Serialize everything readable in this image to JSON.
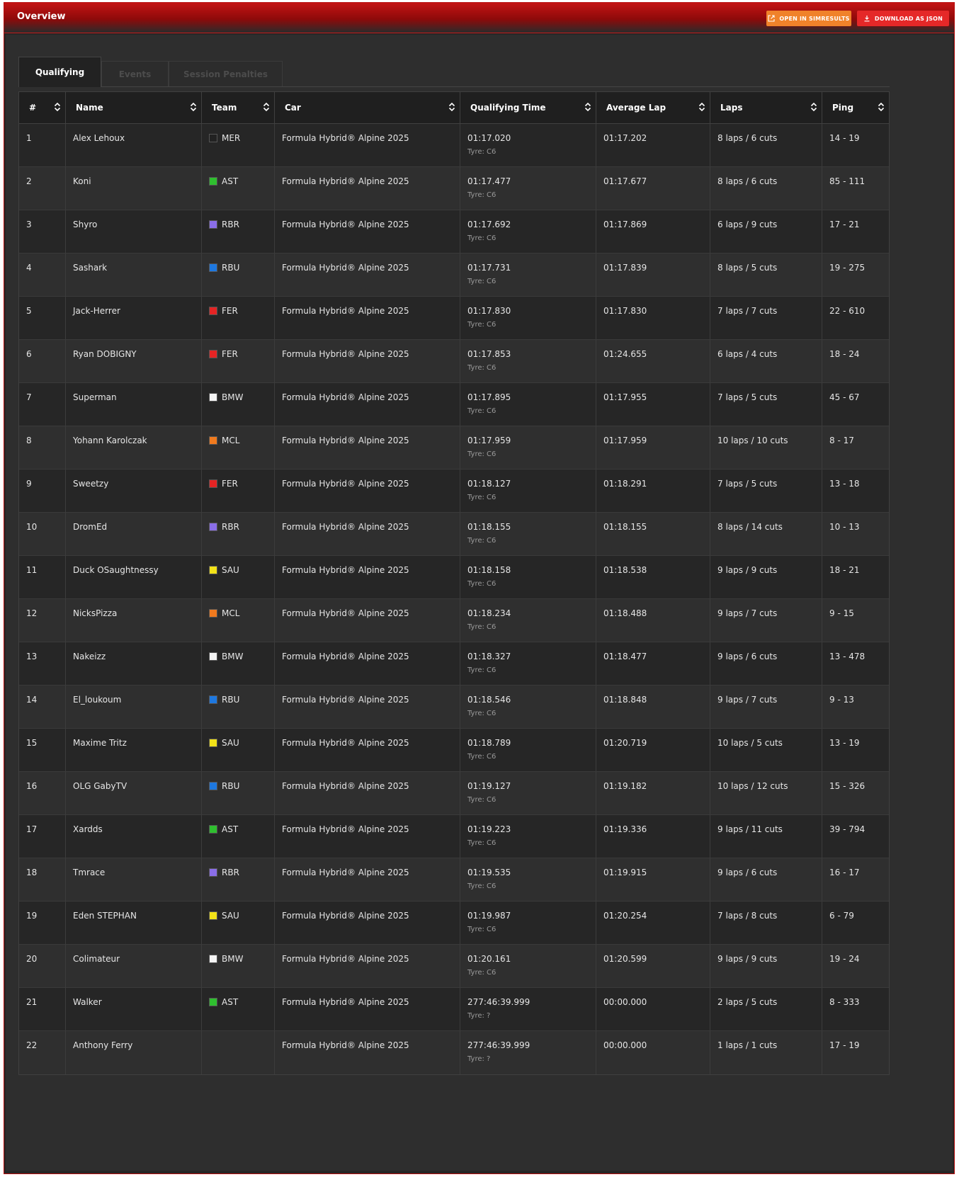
{
  "header": {
    "title": "Overview",
    "open_button": "Open in SimResults",
    "download_button": "Download as JSON",
    "open_icon": "external-link-icon",
    "download_icon": "download-icon"
  },
  "tabs": [
    {
      "label": "Qualifying",
      "active": true
    },
    {
      "label": "Events",
      "active": false
    },
    {
      "label": "Session Penalties",
      "active": false
    }
  ],
  "table": {
    "columns": [
      "#",
      "Name",
      "Team",
      "Car",
      "Qualifying Time",
      "Average Lap",
      "Laps",
      "Ping"
    ],
    "sort_icon": "sort-icon",
    "rows": [
      {
        "pos": "1",
        "name": "Alex Lehoux",
        "team": "MER",
        "team_color": "#222222",
        "car": "Formula Hybrid® Alpine 2025",
        "time": "01:17.020",
        "tyre": "Tyre: C6",
        "avg": "01:17.202",
        "laps": "8 laps / 6 cuts",
        "ping": "14 - 19"
      },
      {
        "pos": "2",
        "name": "Koni",
        "team": "AST",
        "team_color": "#2fbf2f",
        "car": "Formula Hybrid® Alpine 2025",
        "time": "01:17.477",
        "tyre": "Tyre: C6",
        "avg": "01:17.677",
        "laps": "8 laps / 6 cuts",
        "ping": "85 - 111"
      },
      {
        "pos": "3",
        "name": "Shyro",
        "team": "RBR",
        "team_color": "#8a6ee8",
        "car": "Formula Hybrid® Alpine 2025",
        "time": "01:17.692",
        "tyre": "Tyre: C6",
        "avg": "01:17.869",
        "laps": "6 laps / 9 cuts",
        "ping": "17 - 21"
      },
      {
        "pos": "4",
        "name": "Sashark",
        "team": "RBU",
        "team_color": "#1e78e0",
        "car": "Formula Hybrid® Alpine 2025",
        "time": "01:17.731",
        "tyre": "Tyre: C6",
        "avg": "01:17.839",
        "laps": "8 laps / 5 cuts",
        "ping": "19 - 275"
      },
      {
        "pos": "5",
        "name": "Jack-Herrer",
        "team": "FER",
        "team_color": "#e52424",
        "car": "Formula Hybrid® Alpine 2025",
        "time": "01:17.830",
        "tyre": "Tyre: C6",
        "avg": "01:17.830",
        "laps": "7 laps / 7 cuts",
        "ping": "22 - 610"
      },
      {
        "pos": "6",
        "name": "Ryan DOBIGNY",
        "team": "FER",
        "team_color": "#e52424",
        "car": "Formula Hybrid® Alpine 2025",
        "time": "01:17.853",
        "tyre": "Tyre: C6",
        "avg": "01:24.655",
        "laps": "6 laps / 4 cuts",
        "ping": "18 - 24"
      },
      {
        "pos": "7",
        "name": "Superman",
        "team": "BMW",
        "team_color": "#f4f4f4",
        "car": "Formula Hybrid® Alpine 2025",
        "time": "01:17.895",
        "tyre": "Tyre: C6",
        "avg": "01:17.955",
        "laps": "7 laps / 5 cuts",
        "ping": "45 - 67"
      },
      {
        "pos": "8",
        "name": "Yohann Karolczak",
        "team": "MCL",
        "team_color": "#f07a1e",
        "car": "Formula Hybrid® Alpine 2025",
        "time": "01:17.959",
        "tyre": "Tyre: C6",
        "avg": "01:17.959",
        "laps": "10 laps / 10 cuts",
        "ping": "8 - 17"
      },
      {
        "pos": "9",
        "name": "Sweetzy",
        "team": "FER",
        "team_color": "#e52424",
        "car": "Formula Hybrid® Alpine 2025",
        "time": "01:18.127",
        "tyre": "Tyre: C6",
        "avg": "01:18.291",
        "laps": "7 laps / 5 cuts",
        "ping": "13 - 18"
      },
      {
        "pos": "10",
        "name": "DromEd",
        "team": "RBR",
        "team_color": "#8a6ee8",
        "car": "Formula Hybrid® Alpine 2025",
        "time": "01:18.155",
        "tyre": "Tyre: C6",
        "avg": "01:18.155",
        "laps": "8 laps / 14 cuts",
        "ping": "10 - 13"
      },
      {
        "pos": "11",
        "name": "Duck OSaughtnessy",
        "team": "SAU",
        "team_color": "#f2e218",
        "car": "Formula Hybrid® Alpine 2025",
        "time": "01:18.158",
        "tyre": "Tyre: C6",
        "avg": "01:18.538",
        "laps": "9 laps / 9 cuts",
        "ping": "18 - 21"
      },
      {
        "pos": "12",
        "name": "NicksPizza",
        "team": "MCL",
        "team_color": "#f07a1e",
        "car": "Formula Hybrid® Alpine 2025",
        "time": "01:18.234",
        "tyre": "Tyre: C6",
        "avg": "01:18.488",
        "laps": "9 laps / 7 cuts",
        "ping": "9 - 15"
      },
      {
        "pos": "13",
        "name": "Nakeizz",
        "team": "BMW",
        "team_color": "#f4f4f4",
        "car": "Formula Hybrid® Alpine 2025",
        "time": "01:18.327",
        "tyre": "Tyre: C6",
        "avg": "01:18.477",
        "laps": "9 laps / 6 cuts",
        "ping": "13 - 478"
      },
      {
        "pos": "14",
        "name": "El_loukoum",
        "team": "RBU",
        "team_color": "#1e78e0",
        "car": "Formula Hybrid® Alpine 2025",
        "time": "01:18.546",
        "tyre": "Tyre: C6",
        "avg": "01:18.848",
        "laps": "9 laps / 7 cuts",
        "ping": "9 - 13"
      },
      {
        "pos": "15",
        "name": "Maxime Tritz",
        "team": "SAU",
        "team_color": "#f2e218",
        "car": "Formula Hybrid® Alpine 2025",
        "time": "01:18.789",
        "tyre": "Tyre: C6",
        "avg": "01:20.719",
        "laps": "10 laps / 5 cuts",
        "ping": "13 - 19"
      },
      {
        "pos": "16",
        "name": "OLG GabyTV",
        "team": "RBU",
        "team_color": "#1e78e0",
        "car": "Formula Hybrid® Alpine 2025",
        "time": "01:19.127",
        "tyre": "Tyre: C6",
        "avg": "01:19.182",
        "laps": "10 laps / 12 cuts",
        "ping": "15 - 326"
      },
      {
        "pos": "17",
        "name": "Xardds",
        "team": "AST",
        "team_color": "#2fbf2f",
        "car": "Formula Hybrid® Alpine 2025",
        "time": "01:19.223",
        "tyre": "Tyre: C6",
        "avg": "01:19.336",
        "laps": "9 laps / 11 cuts",
        "ping": "39 - 794"
      },
      {
        "pos": "18",
        "name": "Tmrace",
        "team": "RBR",
        "team_color": "#8a6ee8",
        "car": "Formula Hybrid® Alpine 2025",
        "time": "01:19.535",
        "tyre": "Tyre: C6",
        "avg": "01:19.915",
        "laps": "9 laps / 6 cuts",
        "ping": "16 - 17"
      },
      {
        "pos": "19",
        "name": "Eden STEPHAN",
        "team": "SAU",
        "team_color": "#f2e218",
        "car": "Formula Hybrid® Alpine 2025",
        "time": "01:19.987",
        "tyre": "Tyre: C6",
        "avg": "01:20.254",
        "laps": "7 laps / 8 cuts",
        "ping": "6 - 79"
      },
      {
        "pos": "20",
        "name": "Colimateur",
        "team": "BMW",
        "team_color": "#f4f4f4",
        "car": "Formula Hybrid® Alpine 2025",
        "time": "01:20.161",
        "tyre": "Tyre: C6",
        "avg": "01:20.599",
        "laps": "9 laps / 9 cuts",
        "ping": "19 - 24"
      },
      {
        "pos": "21",
        "name": "Walker",
        "team": "AST",
        "team_color": "#2fbf2f",
        "car": "Formula Hybrid® Alpine 2025",
        "time": "277:46:39.999",
        "tyre": "Tyre: ?",
        "avg": "00:00.000",
        "laps": "2 laps / 5 cuts",
        "ping": "8 - 333"
      },
      {
        "pos": "22",
        "name": "Anthony Ferry",
        "team": "",
        "team_color": "",
        "car": "Formula Hybrid® Alpine 2025",
        "time": "277:46:39.999",
        "tyre": "Tyre: ?",
        "avg": "00:00.000",
        "laps": "1 laps / 1 cuts",
        "ping": "17 - 19"
      }
    ]
  }
}
